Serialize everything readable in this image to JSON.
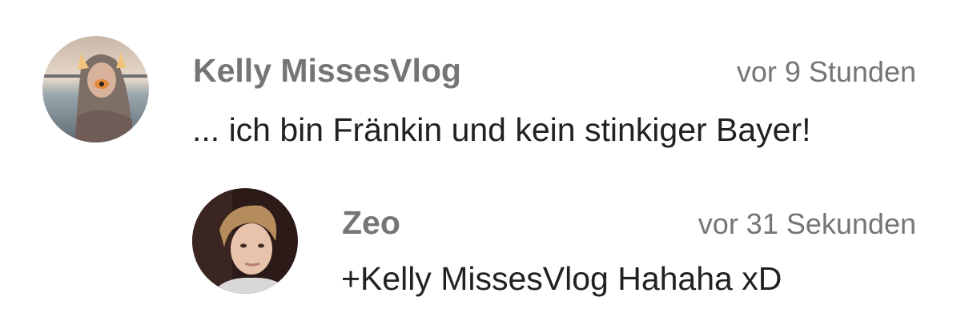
{
  "comments": [
    {
      "author": "Kelly MissesVlog",
      "time": "vor 9 Stunden",
      "text": "... ich bin Fränkin und kein stinkiger Bayer!",
      "avatar_icon": "user-avatar-photo"
    },
    {
      "author": "Zeo",
      "time": "vor 31 Sekunden",
      "text": "+Kelly MissesVlog Hahaha xD",
      "avatar_icon": "user-avatar-photo"
    }
  ],
  "colors": {
    "author": "#757575",
    "time": "#757575",
    "text": "#212121",
    "background": "#ffffff"
  }
}
